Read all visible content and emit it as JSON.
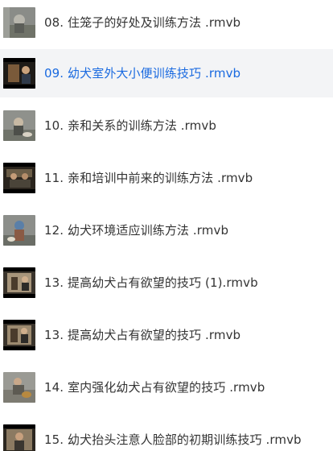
{
  "playlist": {
    "items": [
      {
        "label": "08. 住笼子的好处及训练方法 .rmvb",
        "active": false,
        "thumb": "gray-outdoor"
      },
      {
        "label": "09. 幼犬室外大小便训练技巧 .rmvb",
        "active": true,
        "thumb": "dark-indoor"
      },
      {
        "label": "10. 亲和关系的训练方法 .rmvb",
        "active": false,
        "thumb": "gray-outdoor"
      },
      {
        "label": "11. 亲和培训中前来的训练方法 .rmvb",
        "active": false,
        "thumb": "dark-indoor"
      },
      {
        "label": "12. 幼犬环境适应训练方法 .rmvb",
        "active": false,
        "thumb": "gray-outdoor"
      },
      {
        "label": "13. 提高幼犬占有欲望的技巧 (1).rmvb",
        "active": false,
        "thumb": "dark-indoor"
      },
      {
        "label": "13. 提高幼犬占有欲望的技巧 .rmvb",
        "active": false,
        "thumb": "dark-indoor"
      },
      {
        "label": "14. 室内强化幼犬占有欲望的技巧 .rmvb",
        "active": false,
        "thumb": "gray-outdoor"
      },
      {
        "label": "15. 幼犬抬头注意人脸部的初期训练技巧 .rmvb",
        "active": false,
        "thumb": "dark-indoor"
      }
    ]
  },
  "colors": {
    "active_text": "#1a6ae0",
    "normal_text": "#333333",
    "active_background": "#f3f4f6"
  }
}
